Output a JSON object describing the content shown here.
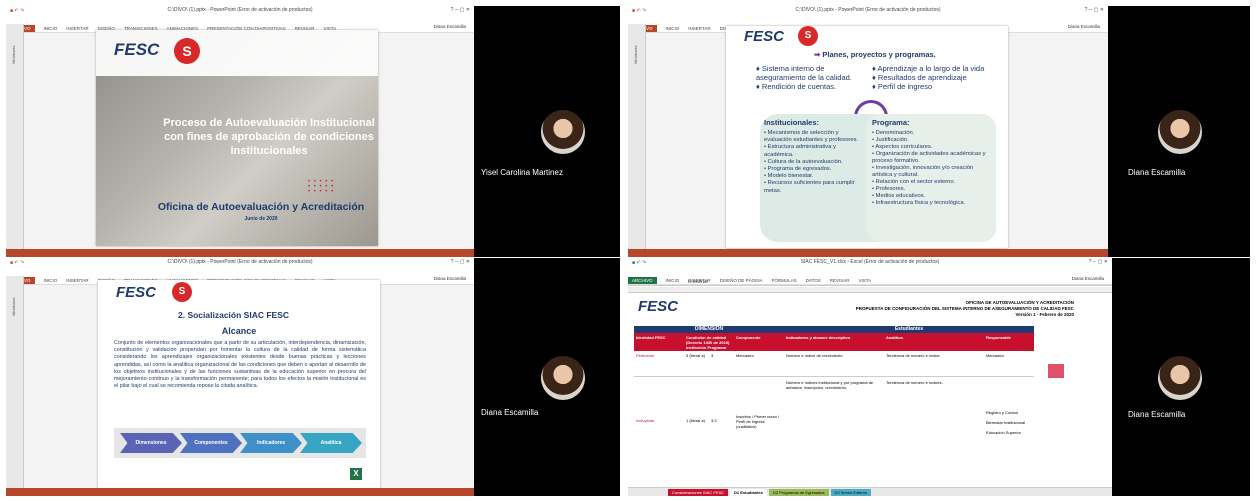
{
  "tiles": {
    "top_left": {
      "window_title": "C:\\DIVO\\ (1).pptx - PowerPoint (Error de activación de productos)",
      "thumbs_label": "Miniaturas",
      "tabs": [
        "ARCHIVO",
        "INICIO",
        "INSERTAR",
        "DISEÑO",
        "TRANSICIONES",
        "ANIMACIONES",
        "PRESENTACIÓN CON DIAPOSITIVAS",
        "REVISAR",
        "VISTA"
      ],
      "user": "Diana Escamilla",
      "slide": {
        "logo": "FESC",
        "title": "Proceso de Autoevaluación Institucional con fines de aprobación de condiciones institucionales",
        "office": "Oficina de Autoevaluación y Acreditación",
        "date": "Junio de 2020"
      },
      "participant": "Yisel Carolina Martinez"
    },
    "top_right": {
      "window_title": "C:\\DIVO\\ (1).pptx - PowerPoint (Error de activación de productos)",
      "thumbs_label": "Miniaturas",
      "tabs": [
        "ARCHIVO",
        "INICIO",
        "INSERTAR",
        "DISEÑO",
        "TRANSICIONES",
        "ANIMACIONES",
        "PRESENTACIÓN CON DIAPOSITIVAS",
        "REVISAR",
        "VISTA"
      ],
      "user": "Diana Escamilla",
      "slide": {
        "logo": "FESC",
        "heading": "Planes, proyectos y programas.",
        "left_items": [
          "Sistema interno de aseguramiento de la calidad.",
          "Rendición de cuentas."
        ],
        "right_items": [
          "Aprendizaje a lo largo de la vida",
          "Resultados de aprendizaje",
          "Perfil de ingreso"
        ],
        "institucionales_title": "Institucionales:",
        "institucionales": [
          "Mecanismos de selección y evaluación estudiantes y profesores.",
          "Estructura administrativa y académica.",
          "Cultura de la autoevaluación.",
          "Programa de egresados.",
          "Modelo bienestar.",
          "Recursos suficientes para cumplir metas."
        ],
        "programa_title": "Programa:",
        "programa": [
          "Denominación.",
          "Justificación.",
          "Aspectos curriculares.",
          "Organización de actividades académicas y proceso formativo.",
          "Investigación, innovación y/o creación artística y cultural.",
          "Relación con el sector externo.",
          "Profesores.",
          "Medios educativos.",
          "Infraestructura física y tecnológica."
        ]
      },
      "participant": "Diana Escamilla"
    },
    "bottom_left": {
      "window_title": "C:\\DIVO\\ (1).pptx - PowerPoint (Error de activación de productos)",
      "thumbs_label": "Miniaturas",
      "tabs": [
        "ARCHIVO",
        "INICIO",
        "INSERTAR",
        "DISEÑO",
        "TRANSICIONES",
        "ANIMACIONES",
        "PRESENTACIÓN CON DIAPOSITIVAS",
        "REVISAR",
        "VISTA"
      ],
      "user": "Diana Escamilla",
      "slide": {
        "logo": "FESC",
        "heading": "2.   Socialización SIAC FESC",
        "subheading": "Alcance",
        "body": "Conjunto de elementos organizacionales que a partir de su articulación, interdependencia, dinamización, constitución y validación propendan por fomentar la cultura de la calidad de forma sistemática considerando los aprendizajes organizacionales existentes desde buenas prácticas y lecciones aprendidas, así como la analítica organizacional de las condiciones que deben o aportan al desarrollo de los objetivos institucionales y de las funciones sustantivas de la educación superior en procura del mejoramiento continuo y la transformación permanente; para todos los efectos la misión institucional es el pilar bajo el cual se recomienda repose la citada analítica.",
        "arrows": [
          "Dimensiones",
          "Componentes",
          "Indicadores",
          "Analítica"
        ]
      },
      "participant": "Diana Escamilla"
    },
    "bottom_right": {
      "window_title": "SIAC FESC_V1.xlsx - Excel (Error de activación de productos)",
      "tabs": [
        "ARCHIVO",
        "INICIO",
        "INSERTAR",
        "DISEÑO DE PÁGINA",
        "FÓRMULAS",
        "DATOS",
        "REVISAR",
        "VISTA"
      ],
      "user": "Diana Escamilla",
      "formula": "Insertar",
      "sheet": {
        "logo": "FESC",
        "header1": "OFICINA DE AUTOEVALUACIÓN Y ACREDITACIÓN",
        "header2": "PROPUESTA DE CONFIGURACIÓN DEL SISTEMA INTERNO DE ASEGURAMIENTO DE CALIDAD FESC",
        "header3": "Versión 1 - Febrero de 2020",
        "dimension": "DIMENSIÓN",
        "estudiantes": "Estudiantes",
        "cols": [
          "Identidad FESC",
          "Condición de calidad (Decreto 1330 de 2019)",
          "Componente",
          "Indicadores y alcance descriptivo",
          "Analítica",
          "Responsable"
        ],
        "sub_cols": [
          "Institución",
          "Programa"
        ],
        "row1": [
          "Pertinente",
          "3 (literal a)",
          "3",
          "Mercadeo",
          "Número e índice de crecimiento",
          "Tendencia de número e índice.",
          "Mercadeo"
        ],
        "row2": [
          "Incluyente",
          "1 (literal a)",
          "3.3",
          "Inscritos / Primer curso / Perfil de ingreso (cualitativo)",
          "Número e índices institucional y por programa de admisión, inscripción, crecimiento.",
          "Tendencia de número e índices.",
          "Registro y Control"
        ],
        "responsables": [
          "Bienestar Institucional",
          "Educación Superior"
        ]
      },
      "sheet_tabs": [
        "Consideraciones SIAC FESC",
        "D1 Estudiantes",
        "D2 Programas de Egresados",
        "D3 Sector Externo"
      ],
      "participant": "Diana Escamilla"
    }
  },
  "colors": {
    "ppt_accent": "#b7472a",
    "excel_accent": "#217346",
    "fesc_blue": "#1f3a6e",
    "fesc_red": "#d8282a"
  }
}
